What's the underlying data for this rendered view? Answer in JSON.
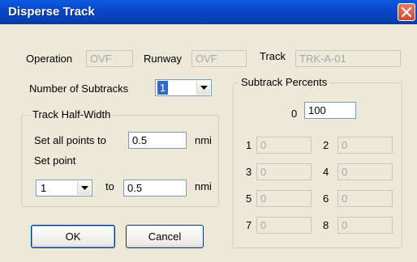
{
  "window": {
    "title": "Disperse Track"
  },
  "header": {
    "operation_label": "Operation",
    "operation_value": "OVF",
    "runway_label": "Runway",
    "runway_value": "OVF",
    "track_label": "Track",
    "track_value": "TRK-A-01"
  },
  "subtracks": {
    "label": "Number of Subtracks",
    "value": "1"
  },
  "half_width": {
    "title": "Track Half-Width",
    "set_all_label": "Set all points to",
    "set_all_value": "0.5",
    "set_all_unit": "nmi",
    "set_point_label": "Set point",
    "point_value": "1",
    "to_label": "to",
    "to_value": "0.5",
    "to_unit": "nmi"
  },
  "percents": {
    "title": "Subtrack Percents",
    "rows": [
      {
        "label": "0",
        "value": "100"
      },
      {
        "label": "1",
        "value": "0"
      },
      {
        "label": "2",
        "value": "0"
      },
      {
        "label": "3",
        "value": "0"
      },
      {
        "label": "4",
        "value": "0"
      },
      {
        "label": "5",
        "value": "0"
      },
      {
        "label": "6",
        "value": "0"
      },
      {
        "label": "7",
        "value": "0"
      },
      {
        "label": "8",
        "value": "0"
      }
    ]
  },
  "buttons": {
    "ok": "OK",
    "cancel": "Cancel"
  },
  "colors": {
    "titlebar": "#0a46c8",
    "close": "#d3482c",
    "selection": "#316ac5",
    "dialog": "#ece9d8"
  },
  "icons": {
    "close": "close-icon",
    "dropdown": "chevron-down-icon"
  }
}
